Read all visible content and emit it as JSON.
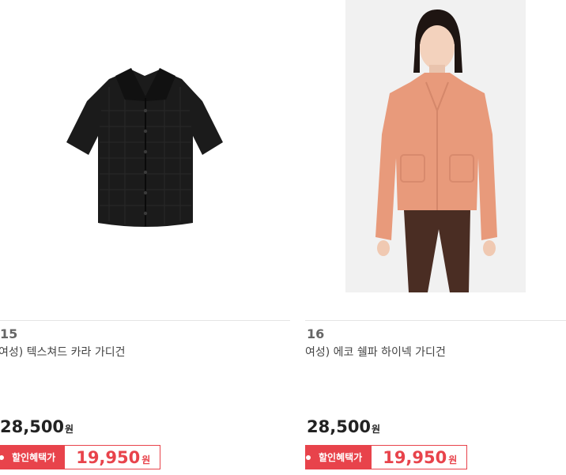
{
  "products": [
    {
      "rank": "15",
      "name": "여성) 텍스쳐드 카라 가디건",
      "price": "28,500",
      "currency": "원",
      "sale_label": "할인혜택가",
      "sale_price": "19,950",
      "image": "black-textured-collar-cardigan"
    },
    {
      "rank": "16",
      "name": "여성) 에코 쉘파 하이넥 가디건",
      "price": "28,500",
      "currency": "원",
      "sale_label": "할인혜택가",
      "sale_price": "19,950",
      "image": "model-wearing-peach-sherpa-highneck-cardigan"
    }
  ],
  "colors": {
    "accent": "#e8434b",
    "text": "#222222",
    "rank": "#666666"
  }
}
